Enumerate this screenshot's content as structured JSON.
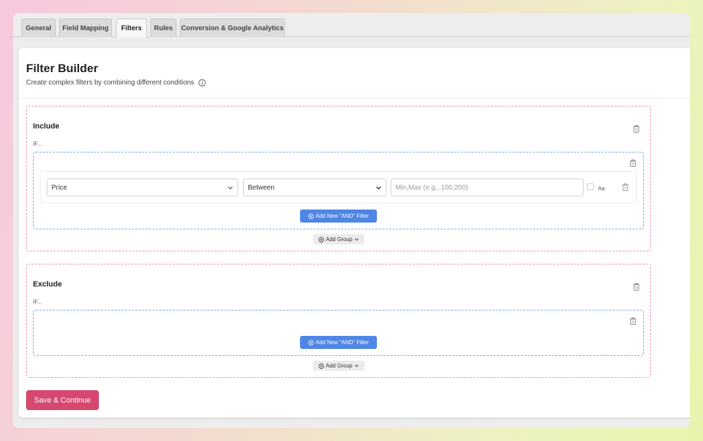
{
  "tabs": [
    {
      "label": "General"
    },
    {
      "label": "Field Mapping"
    },
    {
      "label": "Filters"
    },
    {
      "label": "Rules"
    },
    {
      "label": "Conversion & Google Analytics"
    }
  ],
  "header": {
    "title": "Filter Builder",
    "subtitle": "Create complex filters by combining different conditions"
  },
  "include": {
    "title": "Include",
    "if_label": "IF...",
    "filter": {
      "field": "Price",
      "operator": "Between",
      "value_placeholder": "Min,Max (e.g., 100,200)",
      "case_label": "Aa"
    },
    "add_and_label": "Add New \"AND\" Filter",
    "add_group_label": "Add Group"
  },
  "exclude": {
    "title": "Exclude",
    "if_label": "IF...",
    "add_and_label": "Add New \"AND\" Filter",
    "add_group_label": "Add Group"
  },
  "save_label": "Save & Continue",
  "colors": {
    "primary_button": "#4f86e6",
    "save_button": "#d6486f",
    "section_border": "#f08cb2",
    "group_border": "#6aa8e8"
  }
}
